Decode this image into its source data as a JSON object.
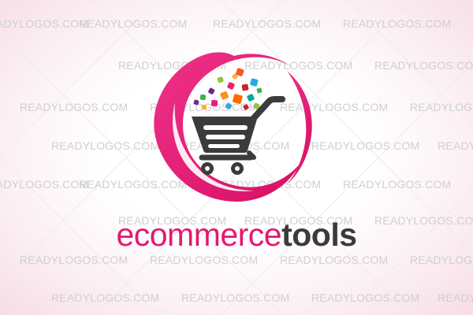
{
  "watermark": {
    "text": "READYLOGOS.COM"
  },
  "brand": {
    "part1": "ecommerce",
    "part2": "tools"
  },
  "logo": {
    "icon": "shopping-cart-icon",
    "ring_color": "#e4196f",
    "cart_color": "#3b3b3b"
  },
  "colors": {
    "accent": "#e4196f",
    "dark": "#3b3b3b",
    "watermark": "#cfcfcf"
  }
}
